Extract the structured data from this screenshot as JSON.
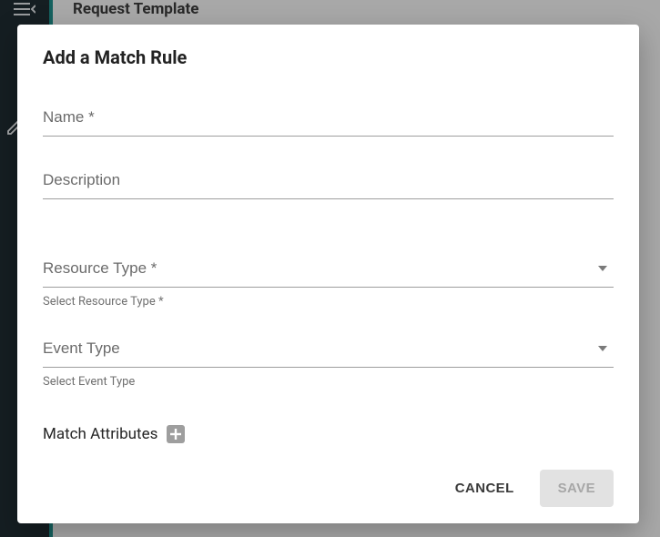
{
  "background": {
    "header_title": "Request Template"
  },
  "modal": {
    "title": "Add a Match Rule",
    "fields": {
      "name": {
        "label": "Name *",
        "value": ""
      },
      "description": {
        "label": "Description",
        "value": ""
      },
      "resource_type": {
        "label": "Resource Type *",
        "helper": "Select Resource Type *",
        "value": ""
      },
      "event_type": {
        "label": "Event Type",
        "helper": "Select Event Type",
        "value": ""
      }
    },
    "match_attributes": {
      "label": "Match Attributes"
    },
    "actions": {
      "cancel": "CANCEL",
      "save": "SAVE"
    }
  }
}
